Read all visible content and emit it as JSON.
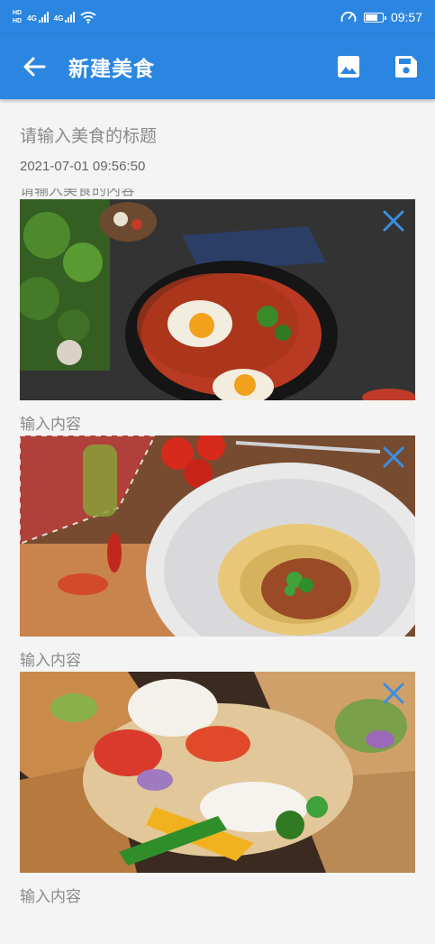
{
  "status_bar": {
    "hd_top": "HD",
    "hd_bottom": "HD",
    "net1": "4G",
    "net2": "4G",
    "time": "09:57",
    "battery_level": 0.7
  },
  "app_bar": {
    "title": "新建美食",
    "back_icon": "arrow-left-icon",
    "image_icon": "image-icon",
    "save_icon": "save-icon"
  },
  "form": {
    "title_placeholder": "请输入美食的标题",
    "date": "2021-07-01 09:56:50",
    "content_placeholder": "请输入美食的内容"
  },
  "photos": [
    {
      "subject": "shakshuka-pan",
      "caption": "输入内容",
      "remove_icon": "close-icon"
    },
    {
      "subject": "spaghetti-bolognese",
      "caption": "输入内容",
      "remove_icon": "close-icon"
    },
    {
      "subject": "tacos",
      "caption": "输入内容",
      "remove_icon": "close-icon"
    }
  ],
  "colors": {
    "primary": "#2a86e0",
    "background": "#f4f4f4",
    "hint_text": "#8a8a8a",
    "close_icon": "#3b8fe0"
  }
}
